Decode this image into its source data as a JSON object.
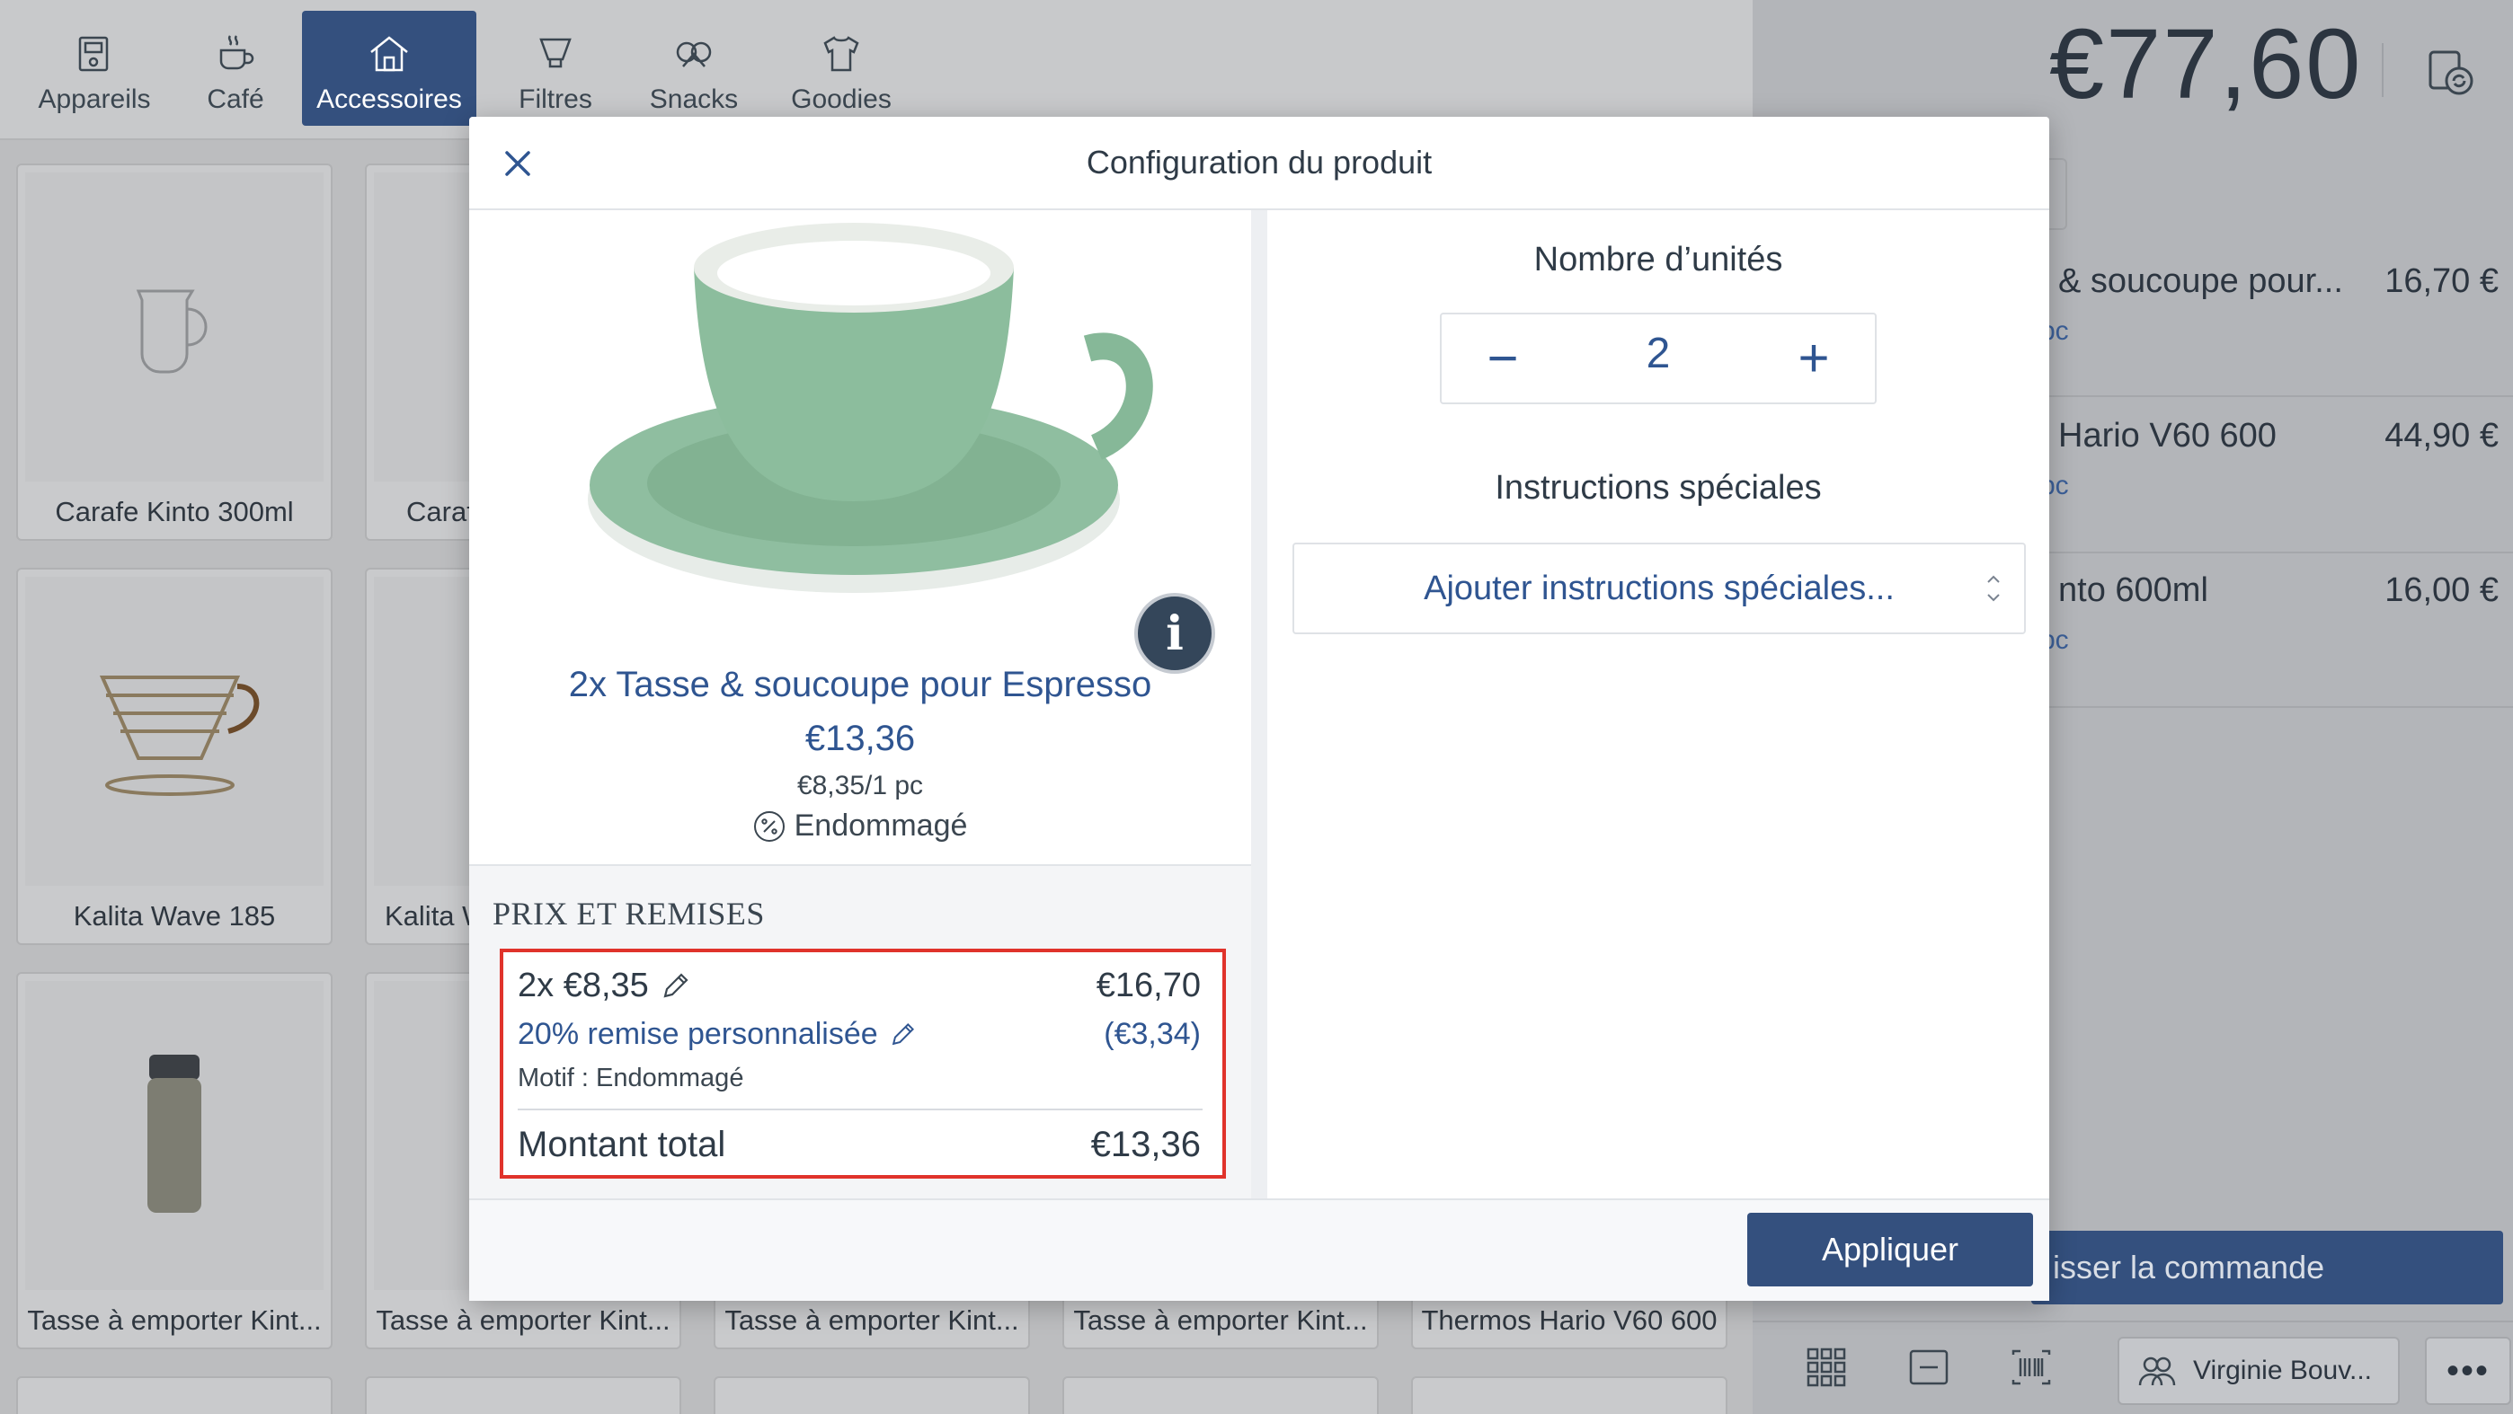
{
  "categories": [
    {
      "label": "Appareils",
      "icon": "appliance-icon",
      "active": false
    },
    {
      "label": "Café",
      "icon": "coffee-cup-icon",
      "active": false
    },
    {
      "label": "Accessoires",
      "icon": "home-icon",
      "active": true
    },
    {
      "label": "Filtres",
      "icon": "filter-icon",
      "active": false
    },
    {
      "label": "Snacks",
      "icon": "pretzel-icon",
      "active": false
    },
    {
      "label": "Goodies",
      "icon": "tshirt-icon",
      "active": false
    }
  ],
  "products": [
    {
      "label": "Carafe Kinto 300ml"
    },
    {
      "label": "Caraf"
    },
    {
      "label": "Kalita Wave 185"
    },
    {
      "label": "Kalita W"
    },
    {
      "label": "Tasse à emporter Kint..."
    },
    {
      "label": "Tasse à emporter Kint..."
    },
    {
      "label": "Tasse à emporter Kint..."
    },
    {
      "label": "Tasse à emporter Kint..."
    },
    {
      "label": "Thermos Hario V60 600"
    }
  ],
  "cart": {
    "total": "€77,60",
    "items": [
      {
        "name": "& soucoupe pour...",
        "sub": "pc",
        "price": "16,70 €"
      },
      {
        "name": "Hario V60 600",
        "sub": "pc",
        "price": "44,90 €"
      },
      {
        "name": "nto 600ml",
        "sub": "pc",
        "price": "16,00 €"
      }
    ],
    "order_button": "isser la commande",
    "user": "Virginie Bouv...",
    "more": "•••"
  },
  "modal": {
    "title": "Configuration du produit",
    "product": {
      "name": "2x Tasse & soucoupe pour Espresso",
      "price": "€13,36",
      "unit_price": "€8,35/1 pc",
      "discount_reason": "Endommagé",
      "info_label": "i"
    },
    "pricing": {
      "section_title": "PRIX ET REMISES",
      "unit_line": "2x €8,35",
      "unit_amount": "€16,70",
      "discount_line": "20% remise personnalisée",
      "discount_amount": "(€3,34)",
      "motif": "Motif : Endommagé",
      "total_label": "Montant total",
      "total_amount": "€13,36"
    },
    "units": {
      "label": "Nombre d’unités",
      "value": "2",
      "minus": "−",
      "plus": "+"
    },
    "instructions": {
      "label": "Instructions spéciales",
      "placeholder": "Ajouter instructions spéciales..."
    },
    "apply_button": "Appliquer"
  },
  "colors": {
    "accent": "#34507e",
    "link": "#2f5591",
    "highlight": "#e0332b"
  }
}
